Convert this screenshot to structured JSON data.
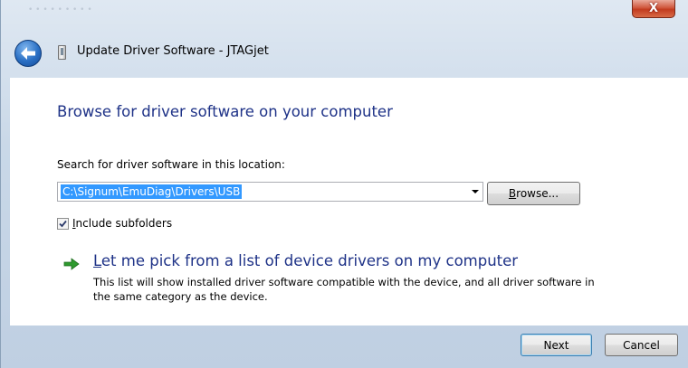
{
  "window": {
    "title": "Update Driver Software - JTAGjet",
    "blurred_caption": "• • • • • • • • •"
  },
  "titlebar": {
    "close_glyph": "X"
  },
  "main": {
    "heading": "Browse for driver software on your computer",
    "search_label": "Search for driver software in this location:",
    "path_value": "C:\\Signum\\EmuDiag\\Drivers\\USB",
    "browse_button": {
      "label_prefix": "",
      "label_underline": "B",
      "label_rest": "rowse..."
    },
    "include_subfolders": {
      "checked": true,
      "label_underline": "I",
      "label_rest": "nclude subfolders"
    },
    "pick_option": {
      "title_underline": "L",
      "title_rest": "et me pick from a list of device drivers on my computer",
      "description": "This list will show installed driver software compatible with the device, and all driver software in the same category as the device."
    }
  },
  "footer": {
    "next_label": "Next",
    "cancel_label": "Cancel"
  },
  "colors": {
    "heading_blue": "#1e3287",
    "selection_blue": "#3399ff",
    "arrow_green": "#2e9a2e"
  }
}
